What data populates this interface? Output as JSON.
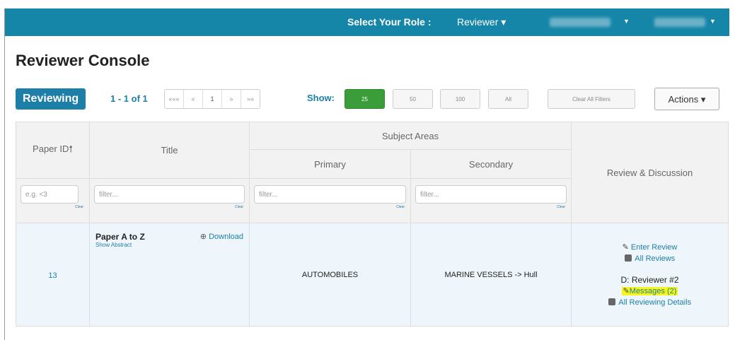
{
  "topbar": {
    "role_label": "Select Your Role :",
    "role_value": "Reviewer ▾"
  },
  "page": {
    "title": "Reviewer Console"
  },
  "toolbar": {
    "tab_label": "Reviewing",
    "range": "1 - 1 of 1",
    "pager": [
      "«««",
      "«",
      "1",
      "»",
      "»»"
    ],
    "show_label": "Show:",
    "page_sizes": [
      "25",
      "50",
      "100",
      "All"
    ],
    "active_page_size": "25",
    "clear_filters_label": "Clear All Filters",
    "actions_label": "Actions ▾"
  },
  "table": {
    "headers": {
      "paper_id": "Paper ID🠕",
      "title": "Title",
      "subject_areas": "Subject Areas",
      "primary": "Primary",
      "secondary": "Secondary",
      "review": "Review & Discussion"
    },
    "filters": {
      "paper_id_placeholder": "e.g. <3",
      "title_placeholder": "filter...",
      "primary_placeholder": "filter...",
      "secondary_placeholder": "filter...",
      "clear_label": "Clear"
    },
    "rows": [
      {
        "paper_id": "13",
        "title": "Paper A to Z",
        "download_label": "Download",
        "show_abstract": "Show Abstract",
        "primary": "AUTOMOBILES",
        "secondary": "MARINE VESSELS -> Hull",
        "enter_review": "Enter Review",
        "all_reviews": "All Reviews",
        "reviewer": "D: Reviewer #2",
        "messages": "Messages (2)",
        "all_details": "All Reviewing Details"
      }
    ]
  },
  "colors": {
    "topbar": "#1686a8",
    "accent": "#1d7ea8",
    "active_green": "#3a9d3a",
    "highlight": "#f5f51a"
  }
}
